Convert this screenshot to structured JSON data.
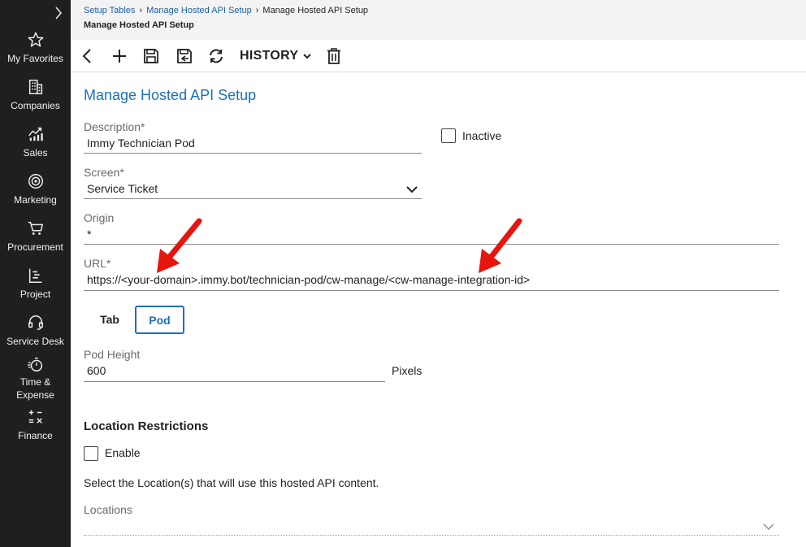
{
  "sidebar": {
    "items": [
      {
        "label": "My Favorites",
        "icon": "star-icon"
      },
      {
        "label": "Companies",
        "icon": "building-icon"
      },
      {
        "label": "Sales",
        "icon": "chart-icon"
      },
      {
        "label": "Marketing",
        "icon": "target-icon"
      },
      {
        "label": "Procurement",
        "icon": "cart-icon"
      },
      {
        "label": "Project",
        "icon": "project-icon"
      },
      {
        "label": "Service Desk",
        "icon": "headset-icon"
      },
      {
        "label_line1": "Time &",
        "label_line2": "Expense",
        "icon": "stopwatch-icon"
      },
      {
        "label": "Finance",
        "icon": "calculator-icon"
      }
    ]
  },
  "breadcrumb": {
    "items": [
      "Setup Tables",
      "Manage Hosted API Setup",
      "Manage Hosted API Setup"
    ],
    "header_title": "Manage Hosted API Setup"
  },
  "toolbar": {
    "history_label": "HISTORY"
  },
  "form": {
    "title": "Manage Hosted API Setup",
    "description": {
      "label": "Description*",
      "value": "Immy Technician Pod"
    },
    "inactive": {
      "label": "Inactive",
      "checked": false
    },
    "screen": {
      "label": "Screen*",
      "value": "Service Ticket"
    },
    "origin": {
      "label": "Origin",
      "value": "*"
    },
    "url": {
      "label": "URL*",
      "value": "https://<your-domain>.immy.bot/technician-pod/cw-manage/<cw-manage-integration-id>"
    },
    "tabs": [
      {
        "label": "Tab",
        "active": false
      },
      {
        "label": "Pod",
        "active": true
      }
    ],
    "pod_height": {
      "label": "Pod Height",
      "value": "600",
      "unit": "Pixels"
    }
  },
  "location": {
    "title": "Location Restrictions",
    "enable": {
      "label": "Enable",
      "checked": false
    },
    "description": "Select the Location(s) that will use this hosted API content.",
    "locations_label": "Locations"
  },
  "colors": {
    "sidebar_bg": "#1f1f1f",
    "accent": "#1d6fbf",
    "annotation_arrow": "#e8140e"
  }
}
